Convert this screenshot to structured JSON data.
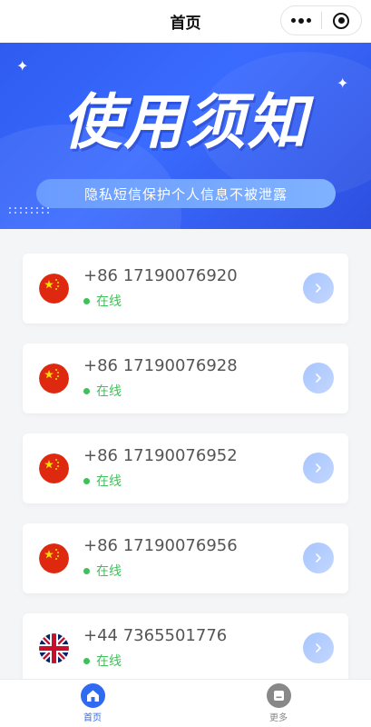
{
  "header": {
    "title": "首页"
  },
  "banner": {
    "title": "使用须知",
    "subtitle": "隐私短信保护个人信息不被泄露"
  },
  "numbers": [
    {
      "phone": "+86 17190076920",
      "status": "在线",
      "flag": "cn-flag-icon"
    },
    {
      "phone": "+86 17190076928",
      "status": "在线",
      "flag": "cn-flag-icon"
    },
    {
      "phone": "+86 17190076952",
      "status": "在线",
      "flag": "cn-flag-icon"
    },
    {
      "phone": "+86 17190076956",
      "status": "在线",
      "flag": "cn-flag-icon"
    },
    {
      "phone": "+44 7365501776",
      "status": "在线",
      "flag": "uk-flag-icon"
    }
  ],
  "tabbar": {
    "home": {
      "label": "首页",
      "icon": "home-icon"
    },
    "more": {
      "label": "更多",
      "icon": "more-icon"
    }
  },
  "colors": {
    "accent": "#3a6bff",
    "online": "#3fc05a",
    "tab_active": "#2f6bf2",
    "tab_inactive": "#888888"
  }
}
